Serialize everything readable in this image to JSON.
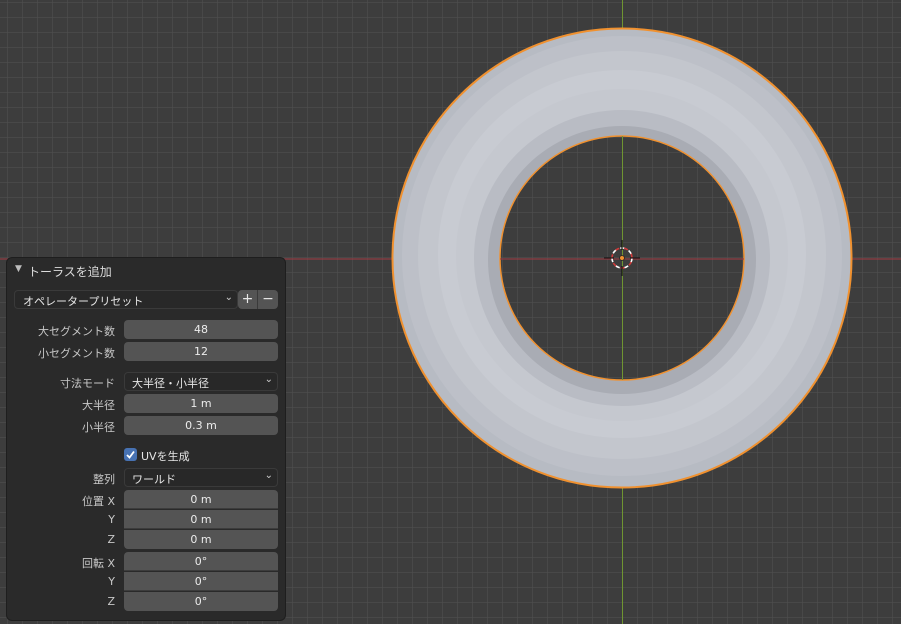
{
  "colors": {
    "background": "#3d3d3d",
    "grid": "#505050",
    "x_axis": "#a33a44",
    "y_axis": "#6f9531",
    "selection_outline": "#f0912f",
    "torus": "#c6c9d0",
    "panel": "#2a2a2a",
    "field": "#545454",
    "checkbox": "#4772b3"
  },
  "panel": {
    "title": "トーラスを追加",
    "collapse_icon": "triangle-down-icon",
    "preset": {
      "label": "オペレータープリセット",
      "add_label": "+",
      "remove_label": "−"
    },
    "major_segments": {
      "label": "大セグメント数",
      "value": "48"
    },
    "minor_segments": {
      "label": "小セグメント数",
      "value": "12"
    },
    "dimensions_mode": {
      "label": "寸法モード",
      "value": "大半径・小半径"
    },
    "major_radius": {
      "label": "大半径",
      "value": "1 m"
    },
    "minor_radius": {
      "label": "小半径",
      "value": "0.3 m"
    },
    "generate_uvs": {
      "label": "UVを生成",
      "checked": true
    },
    "align": {
      "label": "整列",
      "value": "ワールド"
    },
    "location": {
      "label_x": "位置 X",
      "x": "0 m",
      "label_y": "Y",
      "y": "0 m",
      "label_z": "Z",
      "z": "0 m"
    },
    "rotation": {
      "label_x": "回転 X",
      "x": "0°",
      "label_y": "Y",
      "y": "0°",
      "label_z": "Z",
      "z": "0°"
    }
  }
}
